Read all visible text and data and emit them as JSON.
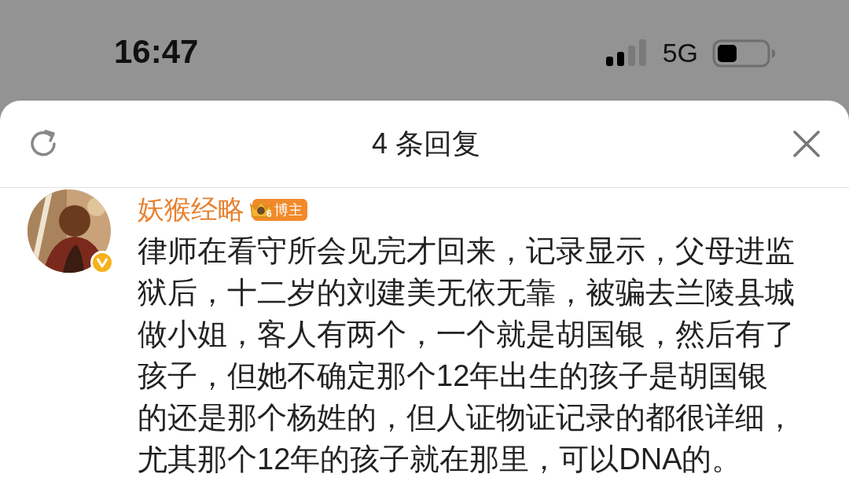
{
  "status_bar": {
    "time": "16:47",
    "network": "5G"
  },
  "sheet": {
    "title": "4 条回复"
  },
  "comment": {
    "author": "妖猴经略",
    "avatar": {
      "verified": true
    },
    "badge": {
      "level": "6",
      "label": "博主"
    },
    "text_lines": [
      "律师在看守所会见完才回来，记录显示，父母进监",
      "狱后，十二岁的刘建美无依无靠，被骗去兰陵县城",
      "做小姐，客人有两个，一个就是胡国银，然后有了",
      "孩子，但她不确定那个12年出生的孩子是胡国银",
      "的还是那个杨姓的，但人证物证记录的都很详细，",
      "尤其那个12年的孩子就在那里，可以DNA的。"
    ]
  }
}
